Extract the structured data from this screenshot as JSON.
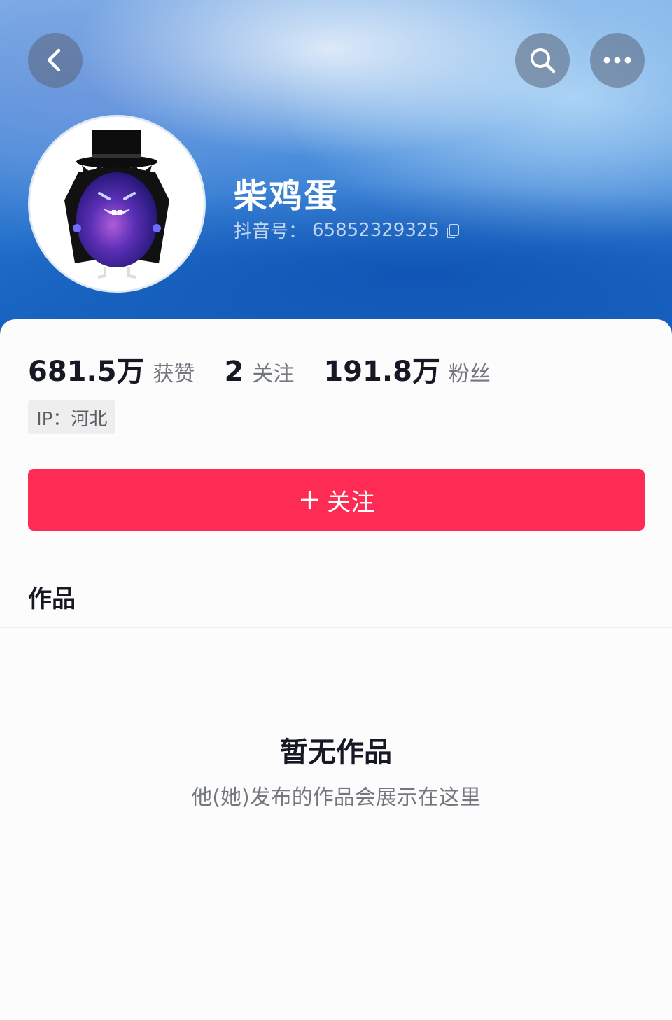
{
  "header": {
    "back_icon": "chevron-left-icon",
    "search_icon": "search-icon",
    "more_icon": "more-dots-icon"
  },
  "profile": {
    "nickname": "柴鸡蛋",
    "douyin_id_label": "抖音号：",
    "douyin_id": "65852329325",
    "avatar": "purple-egg-character-avatar"
  },
  "stats": [
    {
      "value": "681.5万",
      "label": "获赞"
    },
    {
      "value": "2",
      "label": "关注"
    },
    {
      "value": "191.8万",
      "label": "粉丝"
    }
  ],
  "ip_location": "IP：河北",
  "follow_button": {
    "plus": "+",
    "label": "关注"
  },
  "tabs": {
    "works": "作品"
  },
  "empty_state": {
    "title": "暂无作品",
    "subtitle": "他(她)发布的作品会展示在这里"
  },
  "colors": {
    "follow_red": "#fe2c55",
    "header_blue": "#1f6cc8",
    "text_dark": "#161823",
    "text_gray": "#75777f"
  }
}
